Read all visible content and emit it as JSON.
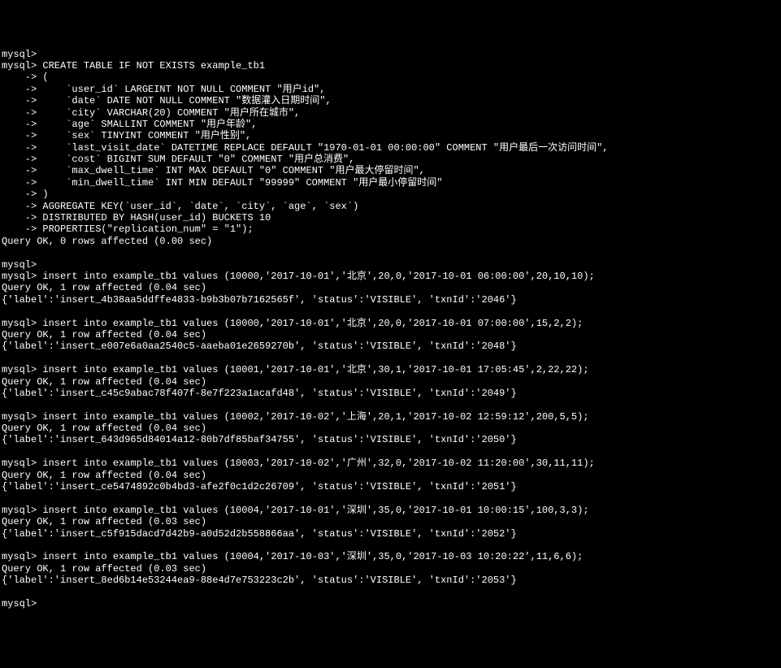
{
  "terminal": {
    "lines": [
      "mysql>",
      "mysql> CREATE TABLE IF NOT EXISTS example_tb1",
      "    -> (",
      "    ->     `user_id` LARGEINT NOT NULL COMMENT \"用户id\",",
      "    ->     `date` DATE NOT NULL COMMENT \"数据灌入日期时间\",",
      "    ->     `city` VARCHAR(20) COMMENT \"用户所在城市\",",
      "    ->     `age` SMALLINT COMMENT \"用户年龄\",",
      "    ->     `sex` TINYINT COMMENT \"用户性别\",",
      "    ->     `last_visit_date` DATETIME REPLACE DEFAULT \"1970-01-01 00:00:00\" COMMENT \"用户最后一次访问时间\",",
      "    ->     `cost` BIGINT SUM DEFAULT \"0\" COMMENT \"用户总消费\",",
      "    ->     `max_dwell_time` INT MAX DEFAULT \"0\" COMMENT \"用户最大停留时间\",",
      "    ->     `min_dwell_time` INT MIN DEFAULT \"99999\" COMMENT \"用户最小停留时间\"",
      "    -> )",
      "    -> AGGREGATE KEY(`user_id`, `date`, `city`, `age`, `sex`)",
      "    -> DISTRIBUTED BY HASH(user_id) BUCKETS 10",
      "    -> PROPERTIES(\"replication_num\" = \"1\");",
      "Query OK, 0 rows affected (0.00 sec)",
      "",
      "mysql>",
      "mysql> insert into example_tb1 values (10000,'2017-10-01','北京',20,0,'2017-10-01 06:00:00',20,10,10);",
      "Query OK, 1 row affected (0.04 sec)",
      "{'label':'insert_4b38aa5ddffe4833-b9b3b07b7162565f', 'status':'VISIBLE', 'txnId':'2046'}",
      "",
      "mysql> insert into example_tb1 values (10000,'2017-10-01','北京',20,0,'2017-10-01 07:00:00',15,2,2);",
      "Query OK, 1 row affected (0.04 sec)",
      "{'label':'insert_e007e6a0aa2540c5-aaeba01e2659270b', 'status':'VISIBLE', 'txnId':'2048'}",
      "",
      "mysql> insert into example_tb1 values (10001,'2017-10-01','北京',30,1,'2017-10-01 17:05:45',2,22,22);",
      "Query OK, 1 row affected (0.04 sec)",
      "{'label':'insert_c45c9abac78f407f-8e7f223a1acafd48', 'status':'VISIBLE', 'txnId':'2049'}",
      "",
      "mysql> insert into example_tb1 values (10002,'2017-10-02','上海',20,1,'2017-10-02 12:59:12',200,5,5);",
      "Query OK, 1 row affected (0.04 sec)",
      "{'label':'insert_643d965d84014a12-80b7df85baf34755', 'status':'VISIBLE', 'txnId':'2050'}",
      "",
      "mysql> insert into example_tb1 values (10003,'2017-10-02','广州',32,0,'2017-10-02 11:20:00',30,11,11);",
      "Query OK, 1 row affected (0.04 sec)",
      "{'label':'insert_ce5474892c0b4bd3-afe2f0c1d2c26709', 'status':'VISIBLE', 'txnId':'2051'}",
      "",
      "mysql> insert into example_tb1 values (10004,'2017-10-01','深圳',35,0,'2017-10-01 10:00:15',100,3,3);",
      "Query OK, 1 row affected (0.03 sec)",
      "{'label':'insert_c5f915dacd7d42b9-a0d52d2b558866aa', 'status':'VISIBLE', 'txnId':'2052'}",
      "",
      "mysql> insert into example_tb1 values (10004,'2017-10-03','深圳',35,0,'2017-10-03 10:20:22',11,6,6);",
      "Query OK, 1 row affected (0.03 sec)",
      "{'label':'insert_8ed6b14e53244ea9-88e4d7e753223c2b', 'status':'VISIBLE', 'txnId':'2053'}",
      "",
      "mysql>"
    ]
  }
}
